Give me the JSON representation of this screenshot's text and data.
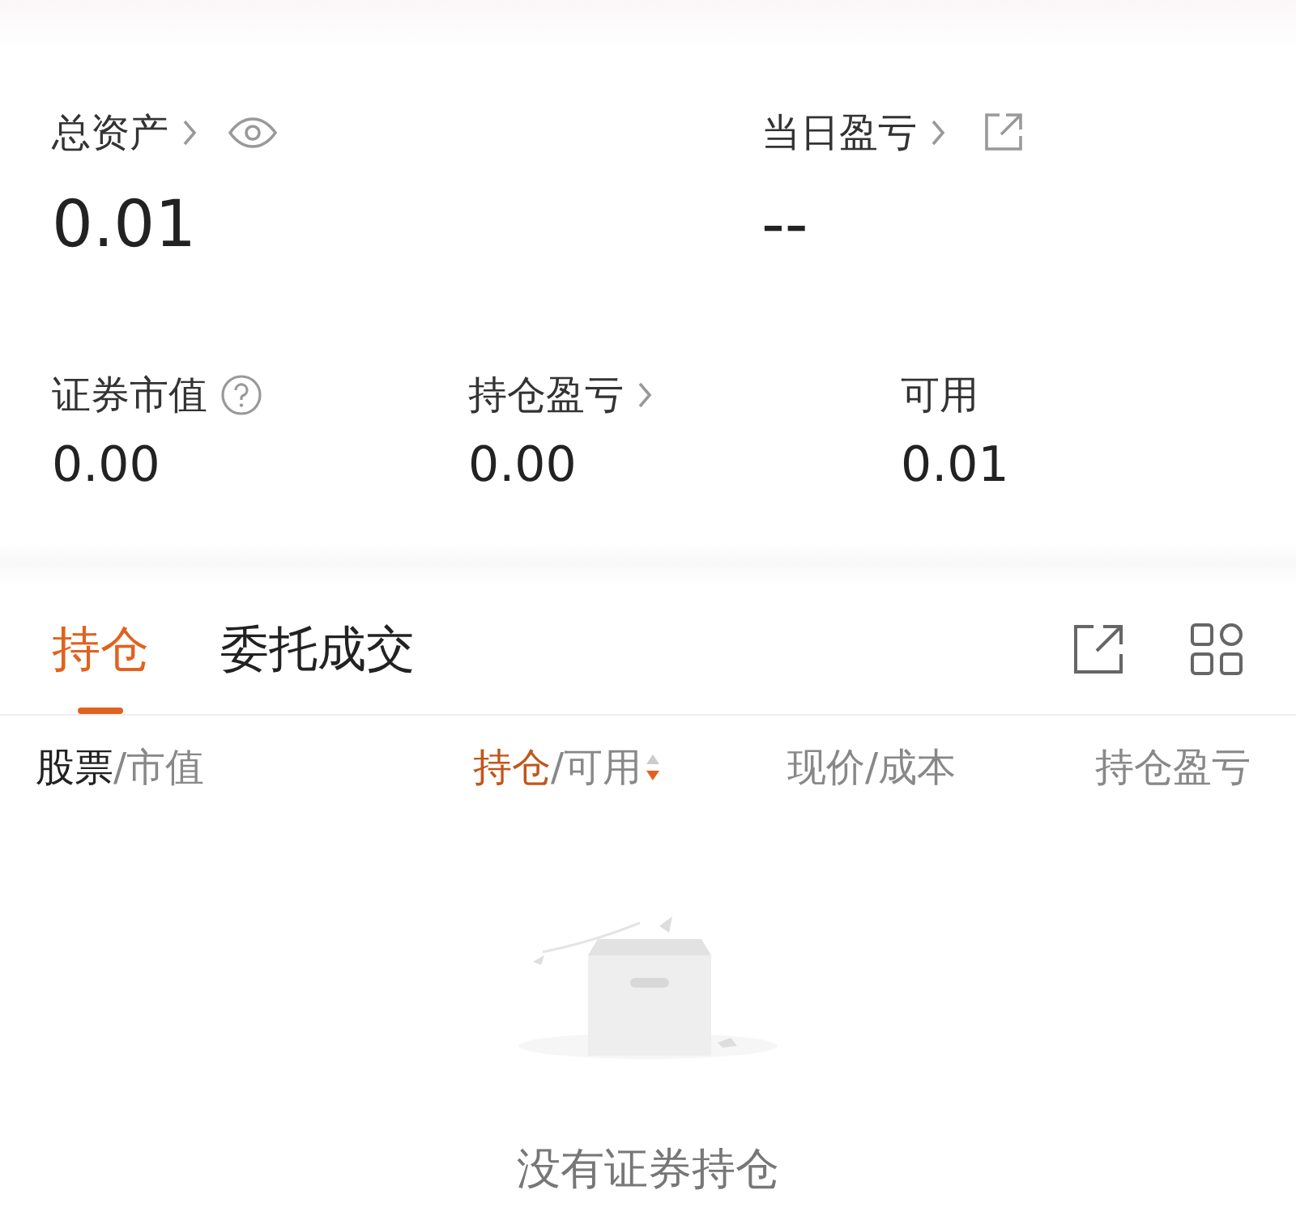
{
  "summary": {
    "total_assets": {
      "label": "总资产",
      "value": "0.01"
    },
    "daily_pnl": {
      "label": "当日盈亏",
      "value": "--"
    },
    "metrics": [
      {
        "label": "证券市值",
        "value": "0.00",
        "kind": "help"
      },
      {
        "label": "持仓盈亏",
        "value": "0.00",
        "kind": "link"
      },
      {
        "label": "可用",
        "value": "0.01",
        "kind": "plain"
      }
    ]
  },
  "tabs": [
    {
      "label": "持仓",
      "selected": true
    },
    {
      "label": "委托成交",
      "selected": false
    }
  ],
  "columns": [
    {
      "main": "股票",
      "rest": "/市值",
      "kind": "key",
      "selected": false
    },
    {
      "main": "持仓",
      "rest": "/可用",
      "kind": "sortable",
      "selected": true
    },
    {
      "main": "现价",
      "rest": "/成本",
      "kind": "plain",
      "selected": false
    },
    {
      "main": "持仓盈亏",
      "kind": "plain",
      "selected": false
    }
  ],
  "empty_state": {
    "message": "没有证券持仓"
  }
}
